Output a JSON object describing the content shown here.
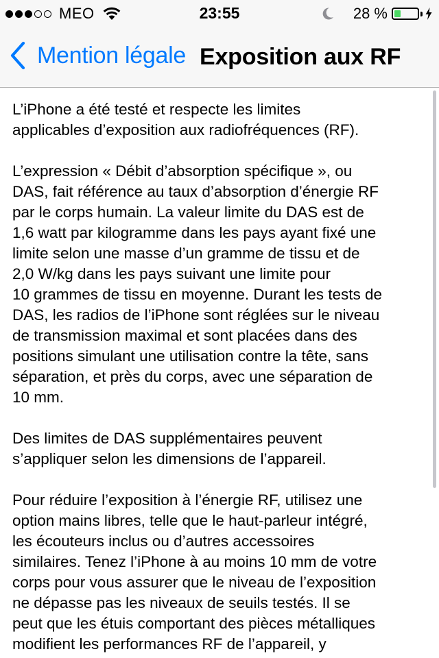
{
  "status_bar": {
    "signal_strength": 3,
    "signal_total": 5,
    "carrier": "MEO",
    "time": "23:55",
    "battery_percent": "28 %",
    "battery_level": 0.28,
    "icons": [
      "wifi-icon",
      "moon-icon",
      "battery-icon",
      "charging-bolt-icon"
    ],
    "battery_color": "#4cd964"
  },
  "nav": {
    "back_label": "Mention légale",
    "title": "Exposition aux RF",
    "accent_color": "#007aff"
  },
  "content": {
    "paragraphs": [
      [
        "L’iPhone a été testé et respecte les limites",
        "applicables d’exposition aux radiofréquences (RF)."
      ],
      [
        "L’expression « Débit d’absorption spécifique », ou",
        "DAS, fait référence au taux d’absorption d’énergie RF",
        "par le corps humain. La valeur limite du DAS est de",
        "1,6 watt par kilogramme dans les pays ayant fixé une",
        "limite selon une masse d’un gramme de tissu et de",
        "2,0 W/kg dans les pays suivant une limite pour",
        "10 grammes de tissu en moyenne. Durant les tests de",
        "DAS, les radios de l’iPhone sont réglées sur le niveau",
        "de transmission maximal et sont placées dans des",
        "positions simulant une utilisation contre la tête, sans",
        "séparation, et près du corps, avec une séparation de",
        "10 mm."
      ],
      [
        "Des limites de DAS supplémentaires peuvent",
        "s’appliquer selon les dimensions de l’appareil."
      ],
      [
        "Pour réduire l’exposition à l’énergie RF, utilisez une",
        "option mains libres, telle que le haut-parleur intégré,",
        "les écouteurs inclus ou d’autres accessoires",
        "similaires. Tenez l’iPhone à au moins 10 mm de votre",
        "corps pour vous assurer que le niveau de l’exposition",
        "ne dépasse pas les niveaux de seuils testés. Il se",
        "peut que les étuis comportant des pièces métalliques",
        "modifient les performances RF de l’appareil, y"
      ]
    ]
  }
}
